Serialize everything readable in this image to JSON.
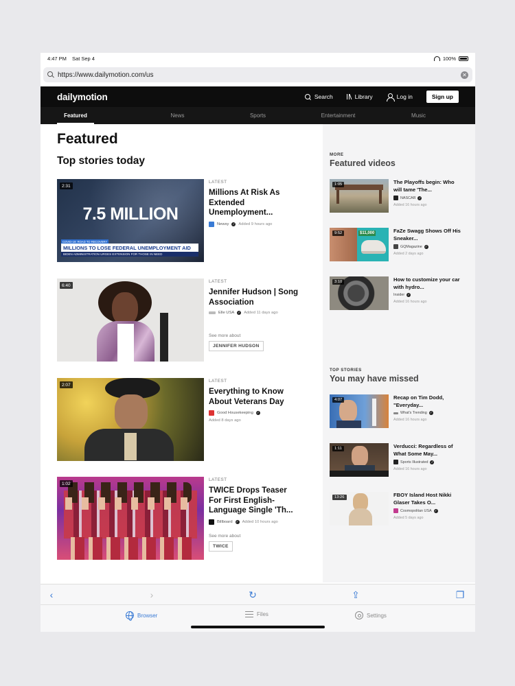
{
  "status": {
    "time": "4:47 PM",
    "date": "Sat Sep 4",
    "battery": "100%"
  },
  "browser": {
    "url": "https://www.dailymotion.com/us"
  },
  "header": {
    "logo": "dailymotion",
    "search": "Search",
    "library": "Library",
    "login": "Log in",
    "signup": "Sign up"
  },
  "categories": [
    "Featured",
    "News",
    "Sports",
    "Entertainment",
    "Music"
  ],
  "main": {
    "title": "Featured",
    "subtitle": "Top stories today",
    "cards": [
      {
        "duration": "2:31",
        "tag": "LATEST",
        "title": "Millions At Risk As Extended Unemployment...",
        "channel": "Newsy",
        "added": "Added 9 hours ago",
        "thumb_big": "7.5 MILLION",
        "thumb_banner": "MILLIONS TO LOSE FEDERAL UNEMPLOYMENT AID",
        "thumb_sub": "BIDEN ADMINISTRATION URGES EXTENSION FOR THOSE IN NEED",
        "thumb_kicker": "COVID-19: ROAD TO RECOVERY"
      },
      {
        "duration": "6:40",
        "tag": "LATEST",
        "title": "Jennifer Hudson | Song Association",
        "channel": "Elle USA",
        "added": "Added 11 days ago",
        "see_more": "See more about",
        "chip": "JENNIFER HUDSON"
      },
      {
        "duration": "2:07",
        "tag": "LATEST",
        "title": "Everything to Know About Veterans Day",
        "channel": "Good Housekeeping",
        "added": "Added 8 days ago"
      },
      {
        "duration": "1:02",
        "tag": "LATEST",
        "title": "TWICE Drops Teaser For First English-Language Single 'Th...",
        "channel": "Billboard",
        "added": "Added 10 hours ago",
        "see_more": "See more about",
        "chip": "TWICE"
      }
    ]
  },
  "sidebar": {
    "featured": {
      "kicker": "MORE",
      "title": "Featured videos",
      "items": [
        {
          "duration": "1:05",
          "title": "The Playoffs begin: Who will tame 'The...",
          "channel": "NASCAR",
          "added": "Added 16 hours ago"
        },
        {
          "duration": "9:52",
          "title": "FaZe Swagg Shows Off His Sneaker...",
          "channel": "GQMagazine",
          "added": "Added 2 days ago",
          "thumb_price": "$11,000"
        },
        {
          "duration": "3:10",
          "title": "How to customize your car with hydro...",
          "channel": "Insider",
          "added": "Added 16 hours ago"
        }
      ]
    },
    "missed": {
      "kicker": "TOP STORIES",
      "title": "You may have missed",
      "items": [
        {
          "duration": "4:07",
          "title": "Recap on Tim Dodd, \"Everyday...",
          "channel": "What's Trending",
          "added": "Added 16 hours ago"
        },
        {
          "duration": "1:11",
          "title": "Verducci: Regardless of What Some May...",
          "channel": "Sports Illustrated",
          "added": "Added 16 hours ago"
        },
        {
          "duration": "13:26",
          "title": "FBOY Island Host Nikki Glaser Takes O...",
          "channel": "Cosmopolitan USA",
          "added": "Added 5 days ago"
        }
      ]
    }
  },
  "tabbar": {
    "browser": "Browser",
    "files": "Files",
    "settings": "Settings"
  },
  "colors": {
    "accent": "#3a7bd5",
    "header_bg": "#0d0d0d"
  }
}
